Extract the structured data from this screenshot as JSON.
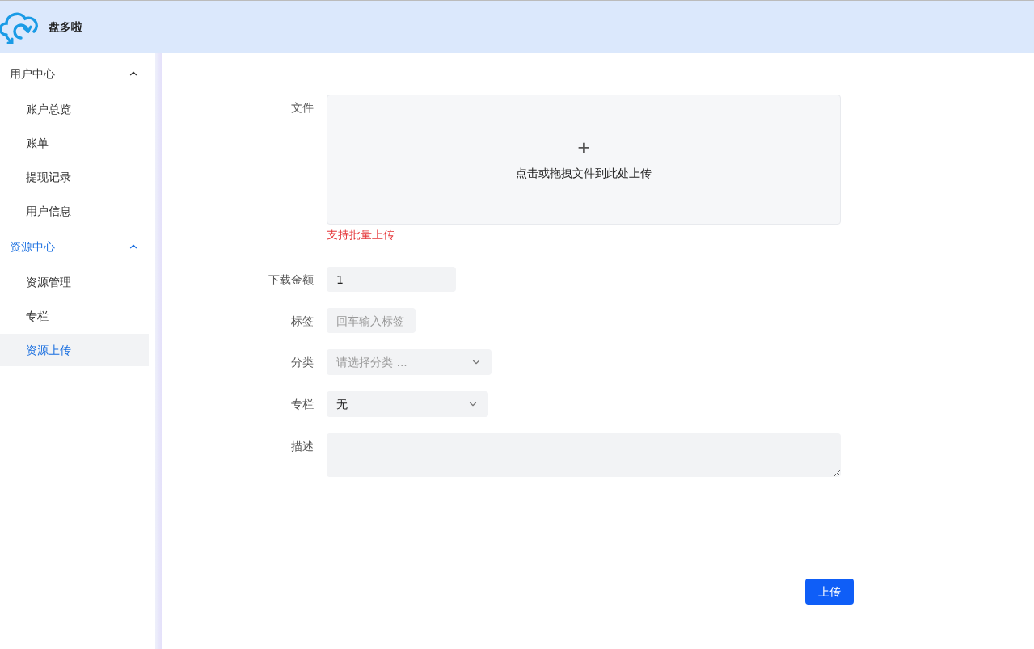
{
  "header": {
    "brand": "盘多啦"
  },
  "sidebar": {
    "groups": [
      {
        "label": "用户中心",
        "expanded": true,
        "selected": false,
        "items": [
          {
            "label": "账户总览",
            "selected": false
          },
          {
            "label": "账单",
            "selected": false
          },
          {
            "label": "提现记录",
            "selected": false
          },
          {
            "label": "用户信息",
            "selected": false
          }
        ]
      },
      {
        "label": "资源中心",
        "expanded": true,
        "selected": true,
        "items": [
          {
            "label": "资源管理",
            "selected": false
          },
          {
            "label": "专栏",
            "selected": false
          },
          {
            "label": "资源上传",
            "selected": true
          }
        ]
      }
    ]
  },
  "form": {
    "fields": [
      {
        "kind": "upload",
        "label": "文件",
        "prompt": "点击或拖拽文件到此处上传",
        "icon_text": "+",
        "hint": "支持批量上传"
      },
      {
        "kind": "input",
        "label": "下载金额",
        "value": "1"
      },
      {
        "kind": "tags",
        "label": "标签",
        "placeholder": "回车输入标签"
      },
      {
        "kind": "select",
        "label": "分类",
        "placeholder": "请选择分类 ..."
      },
      {
        "kind": "select",
        "label": "专栏",
        "value": "无"
      },
      {
        "kind": "textarea",
        "label": "描述"
      }
    ],
    "submit": "上传"
  }
}
